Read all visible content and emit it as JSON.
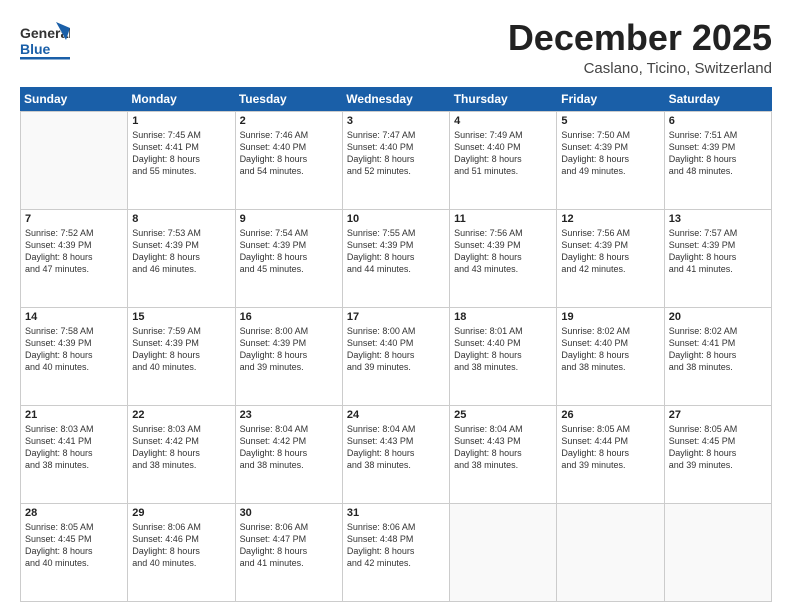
{
  "header": {
    "logo_line1": "General",
    "logo_line2": "Blue",
    "month_title": "December 2025",
    "location": "Caslano, Ticino, Switzerland"
  },
  "days_of_week": [
    "Sunday",
    "Monday",
    "Tuesday",
    "Wednesday",
    "Thursday",
    "Friday",
    "Saturday"
  ],
  "weeks": [
    [
      {
        "day": "",
        "data": ""
      },
      {
        "day": "1",
        "data": "Sunrise: 7:45 AM\nSunset: 4:41 PM\nDaylight: 8 hours\nand 55 minutes."
      },
      {
        "day": "2",
        "data": "Sunrise: 7:46 AM\nSunset: 4:40 PM\nDaylight: 8 hours\nand 54 minutes."
      },
      {
        "day": "3",
        "data": "Sunrise: 7:47 AM\nSunset: 4:40 PM\nDaylight: 8 hours\nand 52 minutes."
      },
      {
        "day": "4",
        "data": "Sunrise: 7:49 AM\nSunset: 4:40 PM\nDaylight: 8 hours\nand 51 minutes."
      },
      {
        "day": "5",
        "data": "Sunrise: 7:50 AM\nSunset: 4:39 PM\nDaylight: 8 hours\nand 49 minutes."
      },
      {
        "day": "6",
        "data": "Sunrise: 7:51 AM\nSunset: 4:39 PM\nDaylight: 8 hours\nand 48 minutes."
      }
    ],
    [
      {
        "day": "7",
        "data": "Sunrise: 7:52 AM\nSunset: 4:39 PM\nDaylight: 8 hours\nand 47 minutes."
      },
      {
        "day": "8",
        "data": "Sunrise: 7:53 AM\nSunset: 4:39 PM\nDaylight: 8 hours\nand 46 minutes."
      },
      {
        "day": "9",
        "data": "Sunrise: 7:54 AM\nSunset: 4:39 PM\nDaylight: 8 hours\nand 45 minutes."
      },
      {
        "day": "10",
        "data": "Sunrise: 7:55 AM\nSunset: 4:39 PM\nDaylight: 8 hours\nand 44 minutes."
      },
      {
        "day": "11",
        "data": "Sunrise: 7:56 AM\nSunset: 4:39 PM\nDaylight: 8 hours\nand 43 minutes."
      },
      {
        "day": "12",
        "data": "Sunrise: 7:56 AM\nSunset: 4:39 PM\nDaylight: 8 hours\nand 42 minutes."
      },
      {
        "day": "13",
        "data": "Sunrise: 7:57 AM\nSunset: 4:39 PM\nDaylight: 8 hours\nand 41 minutes."
      }
    ],
    [
      {
        "day": "14",
        "data": "Sunrise: 7:58 AM\nSunset: 4:39 PM\nDaylight: 8 hours\nand 40 minutes."
      },
      {
        "day": "15",
        "data": "Sunrise: 7:59 AM\nSunset: 4:39 PM\nDaylight: 8 hours\nand 40 minutes."
      },
      {
        "day": "16",
        "data": "Sunrise: 8:00 AM\nSunset: 4:39 PM\nDaylight: 8 hours\nand 39 minutes."
      },
      {
        "day": "17",
        "data": "Sunrise: 8:00 AM\nSunset: 4:40 PM\nDaylight: 8 hours\nand 39 minutes."
      },
      {
        "day": "18",
        "data": "Sunrise: 8:01 AM\nSunset: 4:40 PM\nDaylight: 8 hours\nand 38 minutes."
      },
      {
        "day": "19",
        "data": "Sunrise: 8:02 AM\nSunset: 4:40 PM\nDaylight: 8 hours\nand 38 minutes."
      },
      {
        "day": "20",
        "data": "Sunrise: 8:02 AM\nSunset: 4:41 PM\nDaylight: 8 hours\nand 38 minutes."
      }
    ],
    [
      {
        "day": "21",
        "data": "Sunrise: 8:03 AM\nSunset: 4:41 PM\nDaylight: 8 hours\nand 38 minutes."
      },
      {
        "day": "22",
        "data": "Sunrise: 8:03 AM\nSunset: 4:42 PM\nDaylight: 8 hours\nand 38 minutes."
      },
      {
        "day": "23",
        "data": "Sunrise: 8:04 AM\nSunset: 4:42 PM\nDaylight: 8 hours\nand 38 minutes."
      },
      {
        "day": "24",
        "data": "Sunrise: 8:04 AM\nSunset: 4:43 PM\nDaylight: 8 hours\nand 38 minutes."
      },
      {
        "day": "25",
        "data": "Sunrise: 8:04 AM\nSunset: 4:43 PM\nDaylight: 8 hours\nand 38 minutes."
      },
      {
        "day": "26",
        "data": "Sunrise: 8:05 AM\nSunset: 4:44 PM\nDaylight: 8 hours\nand 39 minutes."
      },
      {
        "day": "27",
        "data": "Sunrise: 8:05 AM\nSunset: 4:45 PM\nDaylight: 8 hours\nand 39 minutes."
      }
    ],
    [
      {
        "day": "28",
        "data": "Sunrise: 8:05 AM\nSunset: 4:45 PM\nDaylight: 8 hours\nand 40 minutes."
      },
      {
        "day": "29",
        "data": "Sunrise: 8:06 AM\nSunset: 4:46 PM\nDaylight: 8 hours\nand 40 minutes."
      },
      {
        "day": "30",
        "data": "Sunrise: 8:06 AM\nSunset: 4:47 PM\nDaylight: 8 hours\nand 41 minutes."
      },
      {
        "day": "31",
        "data": "Sunrise: 8:06 AM\nSunset: 4:48 PM\nDaylight: 8 hours\nand 42 minutes."
      },
      {
        "day": "",
        "data": ""
      },
      {
        "day": "",
        "data": ""
      },
      {
        "day": "",
        "data": ""
      }
    ]
  ]
}
